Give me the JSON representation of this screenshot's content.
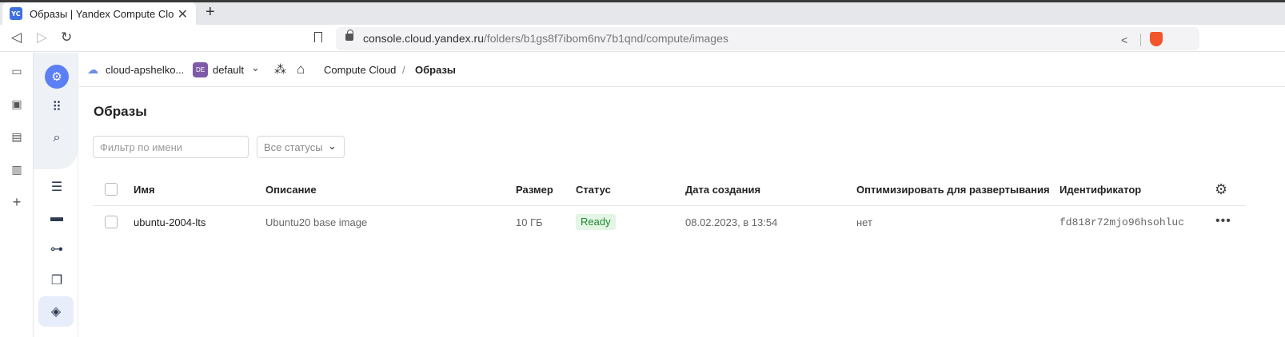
{
  "browser": {
    "tab_title": "Образы | Yandex Compute Cloud",
    "favicon_text": "YC",
    "tab_close_symbol": "✕",
    "newtab_symbol": "+",
    "url_host": "console.cloud.yandex.ru",
    "url_path": "/folders/b1gs8f7ibom6nv7b1qnd/compute/images"
  },
  "header": {
    "cloud_name": "cloud-apshelko...",
    "folder_badge": "DE",
    "folder_name": "default",
    "breadcrumb": [
      "Compute Cloud",
      "Образы"
    ],
    "breadcrumb_separator": "/"
  },
  "main": {
    "title": "Образы",
    "filter_placeholder": "Фильтр по имени",
    "status_filter": "Все статусы"
  },
  "table": {
    "columns": [
      "Имя",
      "Описание",
      "Размер",
      "Статус",
      "Дата создания",
      "Оптимизировать для развертывания",
      "Идентификатор"
    ],
    "rows": [
      {
        "name": "ubuntu-2004-lts",
        "description": "Ubuntu20 base image",
        "size": "10 ГБ",
        "status": "Ready",
        "created": "08.02.2023, в 13:54",
        "optimize": "нет",
        "id": "fd818r72mjo96hsohluc"
      }
    ]
  },
  "colors": {
    "accent": "#5b7ff4",
    "ready_bg": "#e3f5e5",
    "ready_text": "#1f8a32",
    "folder_badge": "#7e5aa8"
  },
  "icons": {
    "rail": [
      "video-icon",
      "wallet-icon",
      "bookmarks-icon",
      "reading-list-icon",
      "add-icon"
    ],
    "nav": [
      "compute-icon",
      "all-services-icon",
      "search-icon",
      "instances-icon",
      "disks-icon",
      "network-icon",
      "snapshots-icon",
      "images-icon"
    ]
  }
}
